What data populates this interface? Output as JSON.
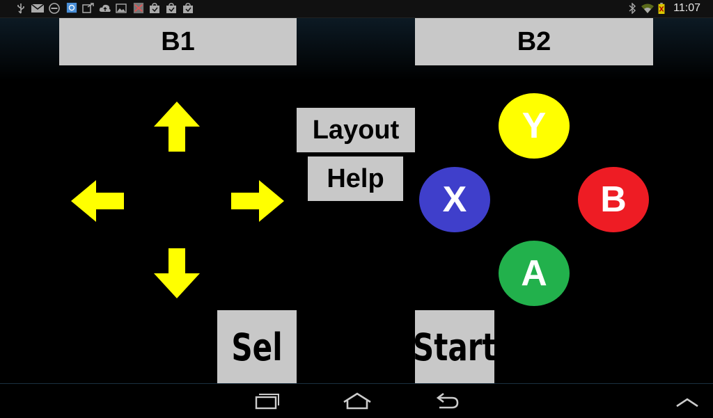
{
  "status_bar": {
    "time": "11:07",
    "icons": [
      "usb-icon",
      "gmail-icon",
      "block-icon",
      "app-icon",
      "sync-icon",
      "cloud-upload-icon",
      "image-icon",
      "app-icon",
      "bag-icon",
      "bag-icon",
      "bag-icon",
      "bluetooth-icon",
      "wifi-icon",
      "battery-icon"
    ]
  },
  "controller": {
    "top_left_label": "B1",
    "top_right_label": "B2",
    "layout_label": "Layout",
    "help_label": "Help",
    "select_label": "Sel",
    "start_label": "Start",
    "face_buttons": {
      "y": {
        "label": "Y",
        "color": "#ffff00"
      },
      "x": {
        "label": "X",
        "color": "#3f3fcb"
      },
      "b": {
        "label": "B",
        "color": "#ee1c24"
      },
      "a": {
        "label": "A",
        "color": "#22b14c"
      }
    },
    "dpad_color": "#ffff00",
    "button_color": "#c8c8c8"
  },
  "nav_bar": {
    "icons": [
      "recent-apps-icon",
      "home-icon",
      "back-icon",
      "chevron-up-icon"
    ]
  }
}
